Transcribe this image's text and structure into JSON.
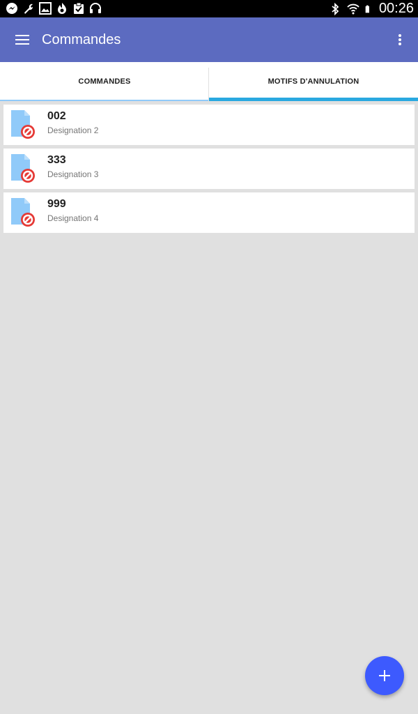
{
  "status_bar": {
    "time": "00:26",
    "left_icons": [
      "messenger-icon",
      "wrench-icon",
      "image-icon",
      "flame-icon",
      "clipboard-check-icon",
      "headphones-icon"
    ],
    "right_icons": [
      "bluetooth-icon",
      "wifi-icon",
      "battery-icon"
    ]
  },
  "app_bar": {
    "title": "Commandes",
    "background": "#5c6bc0"
  },
  "tabs": [
    {
      "label": "COMMANDES",
      "selected": false
    },
    {
      "label": "MOTIFS D'ANNULATION",
      "selected": true
    }
  ],
  "items": [
    {
      "code": "002",
      "designation": "Designation 2"
    },
    {
      "code": "333",
      "designation": "Designation 3"
    },
    {
      "code": "999",
      "designation": "Designation 4"
    }
  ],
  "colors": {
    "accent": "#29a8e0",
    "fab": "#3d5afe",
    "cancel_badge": "#e53935",
    "document": "#90caf9"
  },
  "fab": {
    "icon": "plus-icon"
  }
}
